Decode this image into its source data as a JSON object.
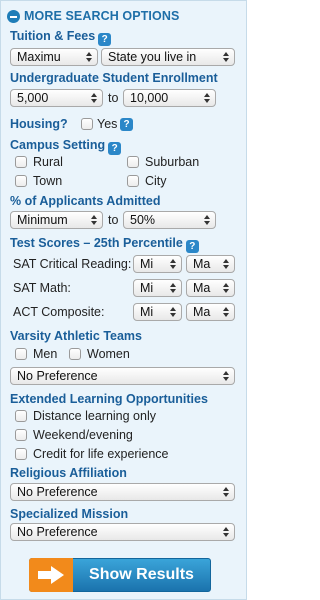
{
  "header": {
    "title": "MORE SEARCH OPTIONS"
  },
  "tuition": {
    "label": "Tuition & Fees",
    "help": "?",
    "select1": "Maximu",
    "select2": "State you live in"
  },
  "enrollment": {
    "label": "Undergraduate Student Enrollment",
    "min": "5,000",
    "to": "to",
    "max": "10,000"
  },
  "housing": {
    "label": "Housing?",
    "yes": "Yes",
    "help": "?"
  },
  "campus": {
    "label": "Campus Setting",
    "help": "?",
    "rural": "Rural",
    "suburban": "Suburban",
    "town": "Town",
    "city": "City"
  },
  "admitted": {
    "label": "% of Applicants Admitted",
    "min": "Minimum",
    "to": "to",
    "max": "50%"
  },
  "test_scores": {
    "label": "Test Scores – 25th Percentile",
    "help": "?",
    "sat_reading": "SAT Critical Reading:",
    "sat_math": "SAT Math:",
    "act": "ACT Composite:",
    "min_short": "Mi",
    "max_short": "Ma"
  },
  "athletics": {
    "label": "Varsity Athletic Teams",
    "men": "Men",
    "women": "Women",
    "select": "No Preference"
  },
  "learning": {
    "label": "Extended Learning Opportunities",
    "distance": "Distance learning only",
    "weekend": "Weekend/evening",
    "credit": "Credit for life experience"
  },
  "religious": {
    "label": "Religious Affiliation",
    "select": "No Preference"
  },
  "specialized": {
    "label": "Specialized Mission",
    "select": "No Preference"
  },
  "submit": {
    "label": "Show Results"
  },
  "colors": {
    "accent": "#1e6fa8",
    "button_blue": "#1b73ad",
    "button_orange": "#f28a1b",
    "panel_bg": "#eaf4fb"
  }
}
